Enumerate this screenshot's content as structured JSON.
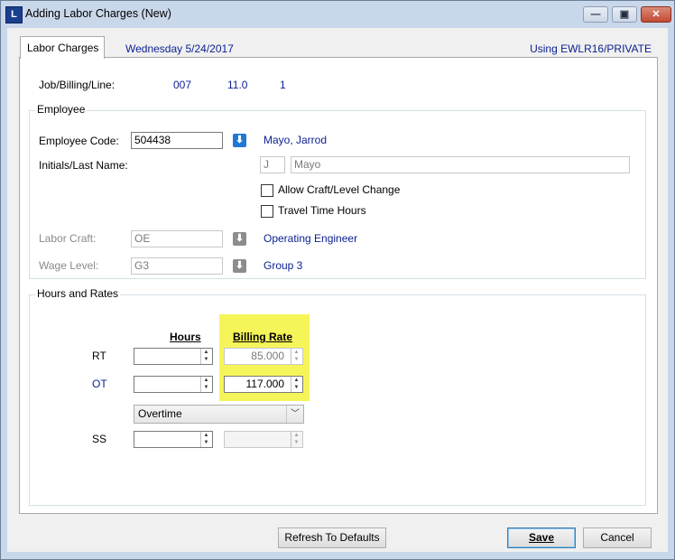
{
  "window": {
    "app_icon": "L",
    "title": "Adding Labor Charges  (New)",
    "min_glyph": "—",
    "max_glyph": "▣",
    "close_glyph": "✕"
  },
  "header": {
    "tab_label": "Labor Charges",
    "date": "Wednesday  5/24/2017",
    "using": "Using EWLR16/PRIVATE"
  },
  "job": {
    "label": "Job/Billing/Line:",
    "job": "007",
    "billing": "11.0",
    "line": "1"
  },
  "employee": {
    "group_title": "Employee",
    "code_label": "Employee Code:",
    "code_value": "504438",
    "code_name": "Mayo, Jarrod",
    "initials_label": "Initials/Last Name:",
    "initial": "J",
    "last_name": "Mayo",
    "allow_craft_label": "Allow Craft/Level Change",
    "allow_craft_checked": false,
    "travel_label": "Travel Time Hours",
    "travel_checked": false,
    "craft_label": "Labor Craft:",
    "craft_value": "OE",
    "craft_name": "Operating Engineer",
    "wage_label": "Wage Level:",
    "wage_value": "G3",
    "wage_name": "Group 3",
    "lookup_glyph": "⬇"
  },
  "hours": {
    "group_title": "Hours and Rates",
    "hours_header": "Hours",
    "rate_header": "Billing Rate",
    "rt_label": "RT",
    "rt_hours": "",
    "rt_rate": "85.000",
    "ot_label": "OT",
    "ot_hours": "",
    "ot_rate": "117.000",
    "ot_type": "Overtime",
    "ss_label": "SS",
    "ss_hours": "",
    "ss_rate": "",
    "highlight_color": "#f5f55a"
  },
  "buttons": {
    "refresh": "Refresh To Defaults",
    "save": "Save",
    "cancel": "Cancel"
  }
}
